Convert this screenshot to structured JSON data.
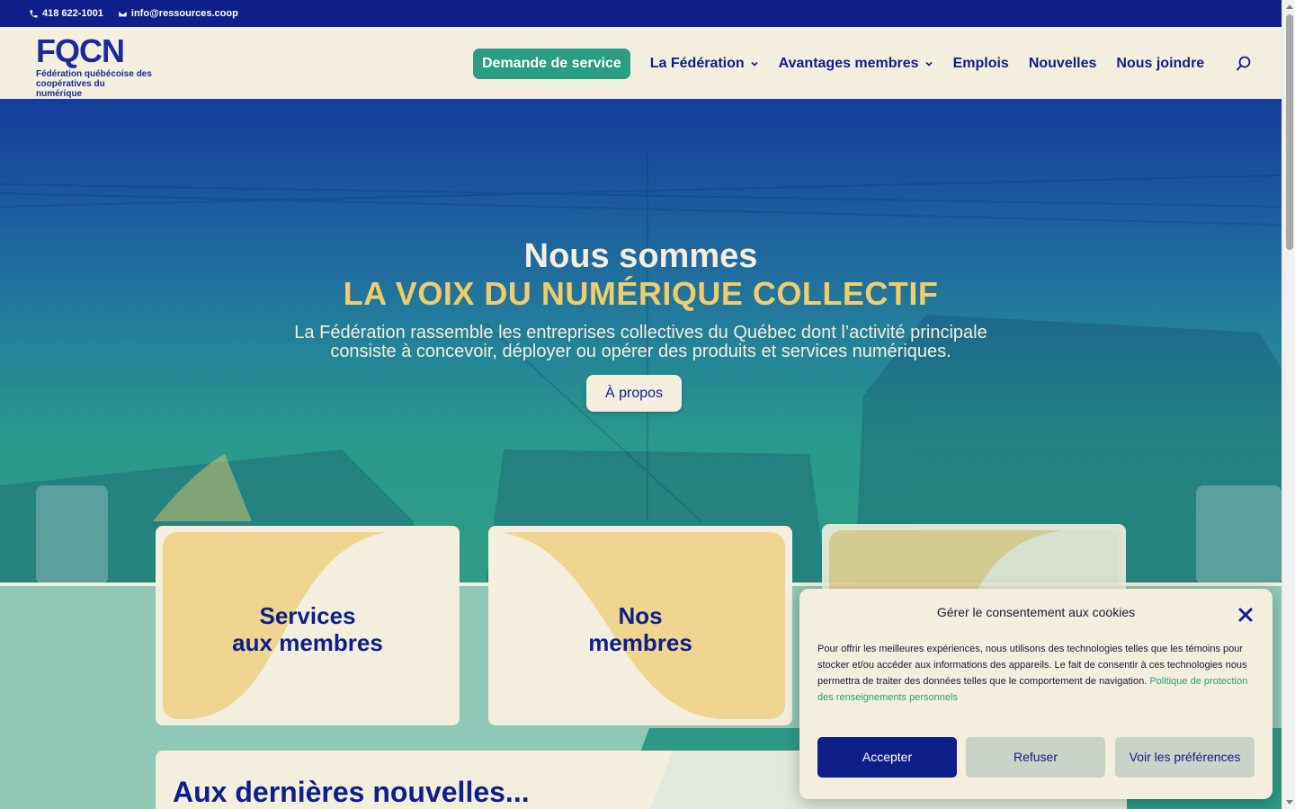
{
  "topbar": {
    "phone": "418 622-1001",
    "email": "info@ressources.coop"
  },
  "logo": {
    "mark": "FQCN",
    "subtitle_line1": "Fédération québécoise des",
    "subtitle_line2": "coopératives du numérique"
  },
  "nav": {
    "cta": "Demande de service",
    "items": [
      {
        "label": "La Fédération",
        "dropdown": true
      },
      {
        "label": "Avantages membres",
        "dropdown": true
      },
      {
        "label": "Emplois",
        "dropdown": false
      },
      {
        "label": "Nouvelles",
        "dropdown": false
      },
      {
        "label": "Nous joindre",
        "dropdown": false
      }
    ]
  },
  "hero": {
    "title": "Nous sommes",
    "subtitle": "LA VOIX DU NUMÉRIQUE COLLECTIF",
    "description": "La Fédération rassemble les entreprises collectives du Québec dont l’activité principale consiste à concevoir, déployer ou opérer des produits et services numériques.",
    "button": "À propos"
  },
  "cards": [
    {
      "line1": "Services",
      "line2": "aux membres"
    },
    {
      "line1": "Nos",
      "line2": "membres"
    },
    {
      "line1": "",
      "line2": ""
    }
  ],
  "news": {
    "title": "Aux dernières nouvelles..."
  },
  "cookie": {
    "title": "Gérer le consentement aux cookies",
    "text": "Pour offrir les meilleures expériences, nous utilisons des technologies telles que les témoins pour stocker et/ou accéder aux informations des appareils. Le fait de consentir à ces technologies nous permettra de traiter des données telles que le comportement de navigation.",
    "policy_link": "Politique de protection des renseignements personnels",
    "accept": "Accepter",
    "refuse": "Refuser",
    "preferences": "Voir les préférences"
  },
  "colors": {
    "navy": "#0f1f8a",
    "teal": "#2a9d84",
    "cream": "#f3eedd",
    "gold": "#f0cc6b"
  }
}
